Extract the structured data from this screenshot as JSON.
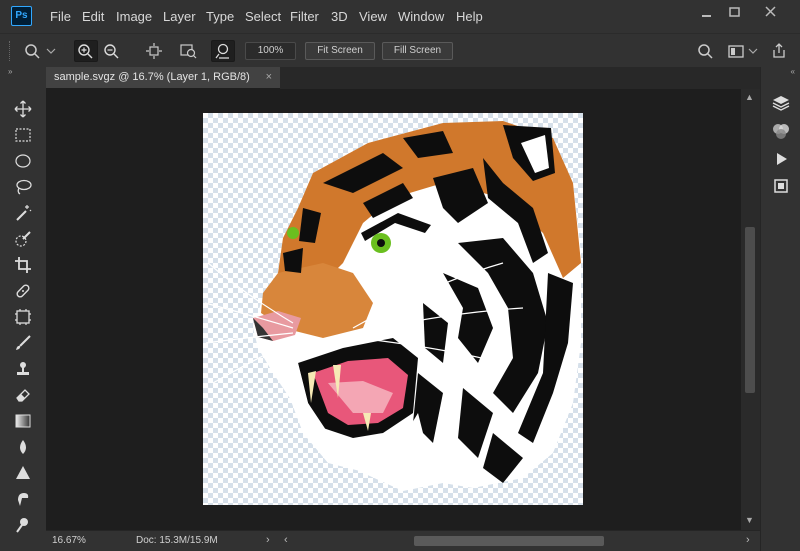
{
  "app": {
    "logo": "Ps"
  },
  "menu": [
    "File",
    "Edit",
    "Image",
    "Layer",
    "Type",
    "Select",
    "Filter",
    "3D",
    "View",
    "Window",
    "Help"
  ],
  "window_controls": [
    "minimize-icon",
    "restore-icon",
    "close-icon"
  ],
  "options": {
    "zoom_value": "100%",
    "fit_screen": "Fit Screen",
    "fill_screen": "Fill Screen"
  },
  "tab": {
    "title": "sample.svgz @ 16.7% (Layer 1, RGB/8)",
    "close": "×"
  },
  "status": {
    "zoom": "16.67%",
    "doc": "Doc: 15.3M/15.9M",
    "arrow": "›"
  },
  "tools": [
    "move-tool",
    "rectangular-marquee-tool",
    "elliptical-marquee-tool",
    "lasso-tool",
    "magic-wand-tool",
    "quick-selection-tool",
    "crop-tool",
    "healing-brush-tool",
    "frame-tool",
    "brush-tool",
    "clone-stamp-tool",
    "eraser-tool",
    "gradient-tool",
    "blur-tool",
    "pen-tool",
    "smudge-tool",
    "dodge-tool"
  ],
  "panels": [
    "layers-icon",
    "channels-icon",
    "play-actions-icon",
    "libraries-icon"
  ],
  "colors": {
    "tiger_orange": "#d0782c",
    "tiger_black": "#0d0d0d",
    "eye_green": "#6abf1f",
    "mouth_pink": "#e8577a",
    "accent": "#31a8ff"
  }
}
